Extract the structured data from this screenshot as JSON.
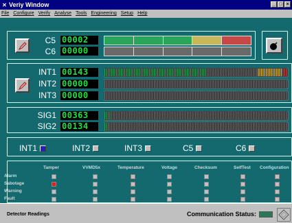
{
  "window": {
    "title": "Veriy Window"
  },
  "menu": [
    "File",
    "Configure",
    "Verify",
    "Analyse",
    "Tools",
    "Engineering",
    "Setup",
    "Help"
  ],
  "levels": [
    {
      "label": "C5",
      "readout": "00002"
    },
    {
      "label": "C6",
      "readout": "00000"
    }
  ],
  "ints": [
    {
      "label": "INT1",
      "readout": "00143",
      "fill": 0.55,
      "peak": 0.83
    },
    {
      "label": "INT2",
      "readout": "00000",
      "fill": 0.0,
      "peak": 0.0
    },
    {
      "label": "INT3",
      "readout": "00000",
      "fill": 0.0,
      "peak": 0.0
    }
  ],
  "sigs": [
    {
      "label": "SIG1",
      "readout": "00363",
      "fill": 0.03
    },
    {
      "label": "SIG2",
      "readout": "00134",
      "fill": 0.02
    }
  ],
  "channels": [
    "INT1",
    "INT2",
    "INT3",
    "C5",
    "C6"
  ],
  "status_cols": [
    "Tamper",
    "VVMD5x",
    "Temperature",
    "Voltage",
    "Checksum",
    "SelfTest",
    "Configuration"
  ],
  "status_rows": [
    "Alarm",
    "Sabotage",
    "Warning",
    "Fault"
  ],
  "statusbar": {
    "left": "Detector Readings",
    "comm": "Communication Status:"
  },
  "colors": {
    "bg": "#14696e",
    "digit": "#20e040",
    "green_bar": "#2aa65a",
    "olive": "#c8b85a",
    "red": "#c84848",
    "yellow": "#e8c030"
  }
}
